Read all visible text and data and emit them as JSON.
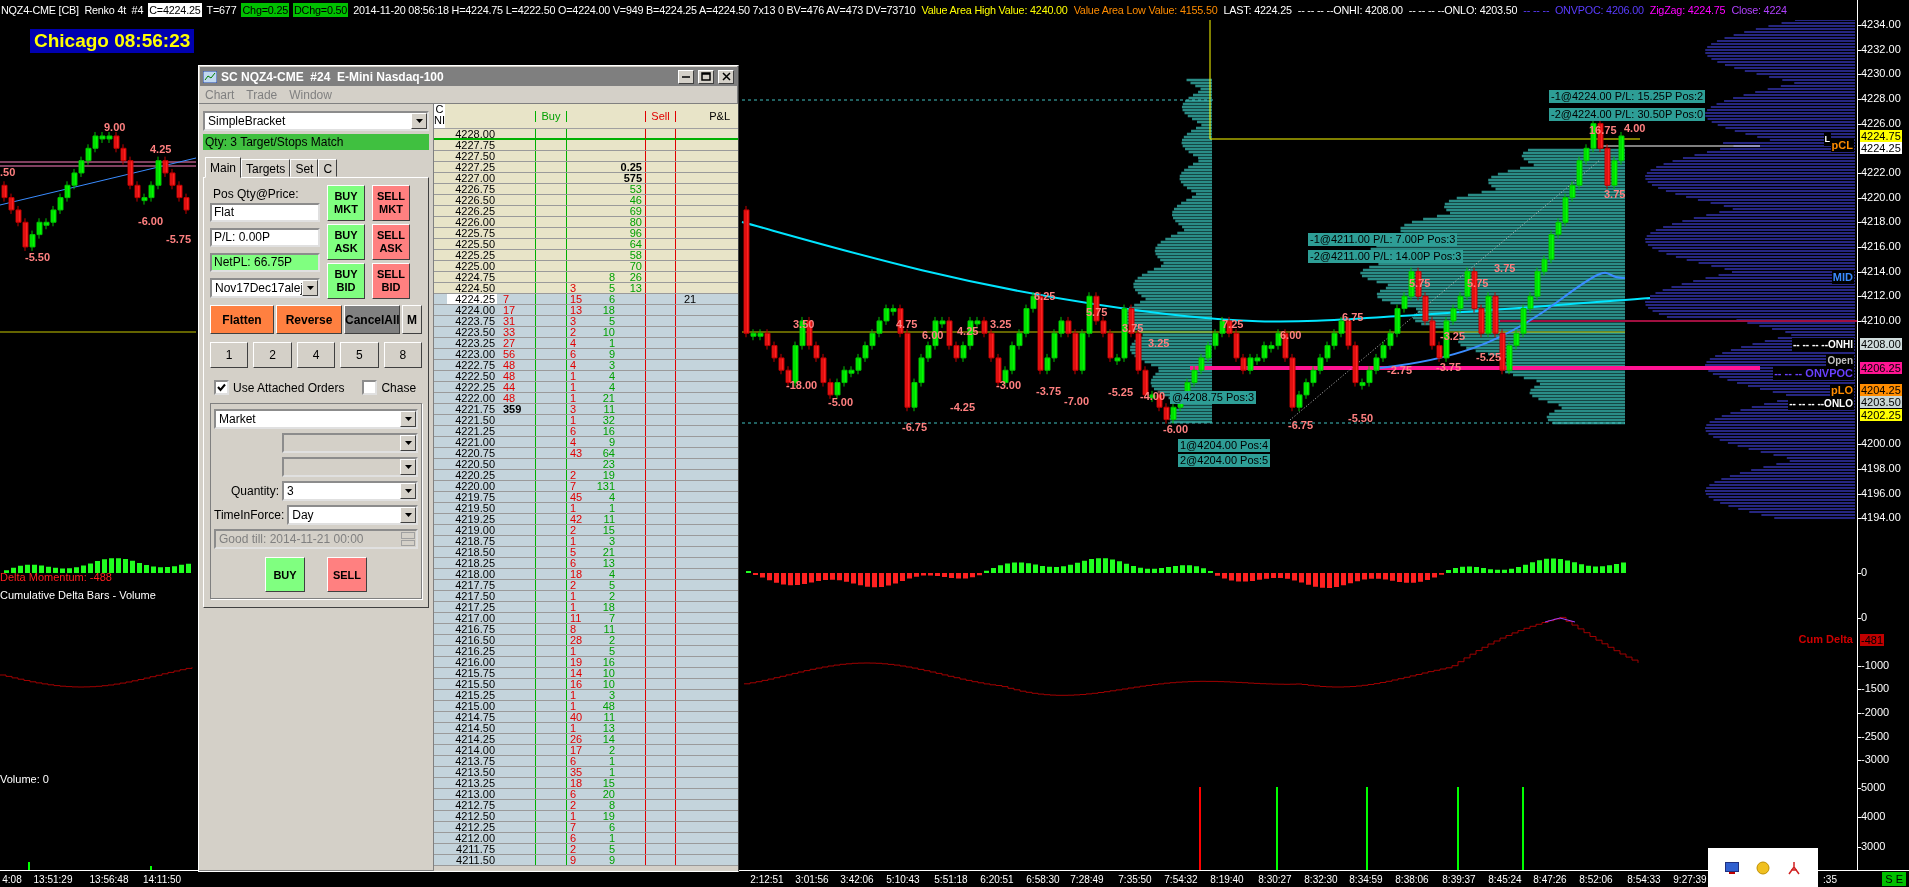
{
  "top_bar": {
    "items": [
      {
        "text": "NQZ4-CME [CB]  Renko 4t  #4",
        "color": "#ffffff",
        "boxed": false
      },
      {
        "text": "C=4224.25",
        "color": "#ffffff",
        "boxed": true
      },
      {
        "text": "T=677",
        "color": "#ffffff",
        "boxed": false
      },
      {
        "text": "Chg=0.25",
        "color": "#00c000",
        "boxed": true
      },
      {
        "text": "DChg=0.50",
        "color": "#00c000",
        "boxed": true
      },
      {
        "text": "2014-11-20 08:56:18 H=4224.75 L=4222.50 O=4224.00 V=949 B=4224.25 A=4224.50 7x13 0 BV=476 AV=473 DV=73710",
        "color": "#ffffff",
        "boxed": false
      },
      {
        "text": "Value Area High Value: 4240.00",
        "color": "#ffff00",
        "boxed": false
      },
      {
        "text": "Value Area Low Value: 4155.50",
        "color": "#ff8c00",
        "boxed": false
      },
      {
        "text": "LAST: 4224.25",
        "color": "#ffffff",
        "boxed": false
      },
      {
        "text": "-- -- -- --ONHI: 4208.00",
        "color": "#ffffff",
        "boxed": false
      },
      {
        "text": "-- -- -- --ONLO: 4203.50",
        "color": "#ffffff",
        "boxed": false
      },
      {
        "text": "-- -- --  ONVPOC: 4206.00",
        "color": "#5a3cff",
        "boxed": false
      },
      {
        "text": "ZigZag: 4224.75",
        "color": "#ff00ff",
        "boxed": false
      },
      {
        "text": "Close: 4224",
        "color": "#b040ff",
        "boxed": false
      }
    ]
  },
  "clock": "Chicago 08:56:23",
  "chart": {
    "swing_labels": [
      ".50",
      "9.00",
      "4.25",
      "-6.00",
      "-5.50",
      "-5.75",
      "3.50",
      "4.75",
      "6.00",
      "4.25",
      "3.25",
      "6.25",
      "5.75",
      "3.75",
      "3.25",
      "7.25",
      "6.00",
      "6.75",
      "5.75",
      "5.75",
      "3.75",
      "16.75",
      "4.00",
      "3.75",
      "-18.00",
      "-5.00",
      "-6.75",
      "-4.25",
      "-3.00",
      "-3.75",
      "-7.00",
      "-5.25",
      "-4.00",
      "-6.00",
      "-6.75",
      "-5.50",
      "-2.75",
      "-3.75",
      "-3.25",
      "-5.25"
    ],
    "order_labels": [
      "-1@4224.00 P/L: 15.25P Pos:2",
      "-2@4224.00 P/L: 30.50P Pos:0",
      "-1@4211.00 P/L: 7.00P Pos:3",
      "-2@4211.00 P/L: 14.00P Pos:3",
      "@4208.75 Pos:3",
      "1@4204.00 Pos:4",
      "2@4204.00 Pos:5"
    ],
    "level_labels": [
      {
        "text": "L",
        "color": "#ffffff"
      },
      {
        "text": "pCL",
        "color": "#ff8c00"
      },
      {
        "text": "MID",
        "color": "#3a8cff"
      },
      {
        "text": "-- -- -- --ONHI",
        "color": "#ffffff"
      },
      {
        "text": "Open",
        "color": "#c0c0c0"
      },
      {
        "text": "-- -- -- ONVPOC",
        "color": "#6a40ff"
      },
      {
        "text": "pLO",
        "color": "#ff8c00"
      },
      {
        "text": "-- -- -- --ONLO",
        "color": "#ffffff"
      },
      {
        "text": "Cum Delta",
        "color": "#d00000"
      }
    ],
    "pane_labels": [
      {
        "text": "Delta Momentum: -488",
        "color": "#ff2020"
      },
      {
        "text": "Cumulative Delta Bars - Volume",
        "color": "#ffffff"
      },
      {
        "text": "Volume: 0",
        "color": "#ffffff"
      }
    ]
  },
  "price_axis": {
    "ticks": [
      "4234.00",
      "4232.00",
      "4230.00",
      "4228.00",
      "4226.00",
      "4222.00",
      "4220.00",
      "4218.00",
      "4216.00",
      "4214.00",
      "4212.00",
      "4210.00",
      "4200.00",
      "4198.00",
      "4196.00",
      "4194.00"
    ],
    "markers": [
      {
        "text": "4224.75",
        "color": "#ffff00"
      },
      {
        "text": "4224.25",
        "color": "#ffffff"
      },
      {
        "text": "4208.00",
        "color": "#d0dcdc"
      },
      {
        "text": "4206.25",
        "color": "#ff1493"
      },
      {
        "text": "4204.25",
        "color": "#ff8c00"
      },
      {
        "text": "4203.50",
        "color": "#c8d4d4"
      },
      {
        "text": "4202.25",
        "color": "#ffff00"
      }
    ],
    "lower_ticks": [
      "0",
      "0",
      "-1000",
      "-1500",
      "-2000",
      "-2500",
      "-3000",
      "5000",
      "4000",
      "3000"
    ],
    "lower_markers": [
      {
        "text": "-481",
        "color": "#c00000"
      }
    ]
  },
  "time_axis": {
    "labels": [
      "4:08",
      "13:51:29",
      "13:56:48",
      "14:11:50",
      "2:12:51",
      "3:01:56",
      "3:42:06",
      "5:10:43",
      "5:51:18",
      "6:20:51",
      "6:58:30",
      "7:28:49",
      "7:35:50",
      "7:54:32",
      "8:19:40",
      "8:30:27",
      "8:32:30",
      "8:34:59",
      "8:38:06",
      "8:39:37",
      "8:45:24",
      "8:47:26",
      "8:52:06",
      "8:54:33",
      "9:27:39",
      ":35"
    ],
    "badge": "S E"
  },
  "order_window": {
    "title": "SC NQZ4-CME  #24  E-Mini Nasdaq-100",
    "menu": [
      {
        "label": "Chart",
        "disabled": true
      },
      {
        "label": "Trade",
        "disabled": true
      },
      {
        "label": "Window",
        "disabled": true
      }
    ],
    "strategy": "SimpleBracket",
    "status": "Qty: 3 Target/Stops Match",
    "tabs": [
      {
        "label": "Main",
        "selected": true
      },
      {
        "label": "Targets",
        "selected": false
      },
      {
        "label": "Set",
        "selected": false
      },
      {
        "label": "C",
        "selected": false
      }
    ],
    "position_label": "Pos Qty@Price:",
    "position": "Flat",
    "pl": "P/L: 0.00P",
    "net_pl": "NetPL: 66.75P",
    "account": "Nov17Dec17alej",
    "trade_buttons": [
      {
        "label": "BUY MKT",
        "kind": "buy"
      },
      {
        "label": "SELL MKT",
        "kind": "sell"
      },
      {
        "label": "BUY ASK",
        "kind": "buy"
      },
      {
        "label": "SELL ASK",
        "kind": "sell"
      },
      {
        "label": "BUY BID",
        "kind": "buy"
      },
      {
        "label": "SELL BID",
        "kind": "sell"
      }
    ],
    "action_buttons": [
      {
        "label": "Flatten",
        "kind": "accent"
      },
      {
        "label": "Reverse",
        "kind": "accent"
      },
      {
        "label": "CancelAll",
        "kind": "dark"
      },
      {
        "label": "M",
        "kind": "plain"
      }
    ],
    "quantity_presets": [
      "1",
      "2",
      "4",
      "5",
      "8"
    ],
    "attached_orders": {
      "label": "Use Attached Orders",
      "checked": true
    },
    "chase": {
      "label": "Chase",
      "checked": false
    },
    "order_type": "Market",
    "extra_dropdowns": [
      {
        "disabled": true
      },
      {
        "disabled": true
      }
    ],
    "quantity_label": "Quantity:",
    "quantity": "3",
    "tif_label": "TimeInForce:",
    "tif": "Day",
    "good_till": {
      "text": "Good till: 2014-11-21 00:00",
      "disabled": true
    },
    "submit_buttons": [
      {
        "label": "BUY",
        "kind": "buy"
      },
      {
        "label": "SELL",
        "kind": "sell"
      }
    ]
  },
  "ladder": {
    "stub_header": [
      "C",
      "NI"
    ],
    "columns": [
      "Buy",
      "Sell",
      "P&L"
    ],
    "rows": [
      {
        "price": "4228.00",
        "kind": "ask",
        "current": false
      },
      {
        "price": "4227.75",
        "kind": "ask",
        "current": false
      },
      {
        "price": "4227.50",
        "kind": "ask",
        "current": false
      },
      {
        "price": "4227.25",
        "kind": "ask",
        "current": false,
        "ask": "0.25",
        "color": "#000000"
      },
      {
        "price": "4227.00",
        "kind": "ask",
        "current": false,
        "ask": "575",
        "color": "#000000"
      },
      {
        "price": "4226.75",
        "kind": "ask",
        "current": false,
        "ask": "53"
      },
      {
        "price": "4226.50",
        "kind": "ask",
        "current": false,
        "ask": "46"
      },
      {
        "price": "4226.25",
        "kind": "ask",
        "current": false,
        "ask": "69"
      },
      {
        "price": "4226.00",
        "kind": "ask",
        "current": false,
        "ask": "80"
      },
      {
        "price": "4225.75",
        "kind": "ask",
        "current": false,
        "ask": "96"
      },
      {
        "price": "4225.50",
        "kind": "ask",
        "current": false,
        "ask": "64"
      },
      {
        "price": "4225.25",
        "kind": "ask",
        "current": false,
        "ask": "58"
      },
      {
        "price": "4225.00",
        "kind": "ask",
        "current": false,
        "ask": "70"
      },
      {
        "price": "4224.75",
        "kind": "ask",
        "current": false,
        "bought": "8",
        "ask": "26"
      },
      {
        "price": "4224.50",
        "kind": "ask",
        "current": false,
        "sold": "3",
        "bought": "5",
        "ask": "13"
      },
      {
        "price": "4224.25",
        "kind": "bid",
        "current": true,
        "bid": "7",
        "sold": "15",
        "bought": "6",
        "pnl": "21"
      },
      {
        "price": "4224.00",
        "kind": "bid",
        "current": false,
        "bid": "17",
        "sold": "13",
        "bought": "18"
      },
      {
        "price": "4223.75",
        "kind": "bid",
        "current": false,
        "bid": "31",
        "sold": "3",
        "bought": "5"
      },
      {
        "price": "4223.50",
        "kind": "bid",
        "current": false,
        "bid": "33",
        "sold": "2",
        "bought": "10"
      },
      {
        "price": "4223.25",
        "kind": "bid",
        "current": false,
        "bid": "27",
        "sold": "4",
        "bought": "1"
      },
      {
        "price": "4223.00",
        "kind": "bid",
        "current": false,
        "bid": "56",
        "sold": "6",
        "bought": "9"
      },
      {
        "price": "4222.75",
        "kind": "bid",
        "current": false,
        "bid": "48",
        "sold": "4",
        "bought": "3"
      },
      {
        "price": "4222.50",
        "kind": "bid",
        "current": false,
        "bid": "48",
        "sold": "1",
        "bought": "4"
      },
      {
        "price": "4222.25",
        "kind": "bid",
        "current": false,
        "bid": "44",
        "sold": "1",
        "bought": "4"
      },
      {
        "price": "4222.00",
        "kind": "bid",
        "current": false,
        "bid": "48",
        "sold": "1",
        "bought": "21"
      },
      {
        "price": "4221.75",
        "kind": "bid",
        "current": false,
        "bid": "359",
        "color": "#000000",
        "sold": "3",
        "bought": "11"
      },
      {
        "price": "4221.50",
        "kind": "bid",
        "current": false,
        "sold": "1",
        "bought": "32"
      },
      {
        "price": "4221.25",
        "kind": "bid",
        "current": false,
        "sold": "6",
        "bought": "16"
      },
      {
        "price": "4221.00",
        "kind": "bid",
        "current": false,
        "sold": "4",
        "bought": "9"
      },
      {
        "price": "4220.75",
        "kind": "bid",
        "current": false,
        "sold": "43",
        "bought": "64"
      },
      {
        "price": "4220.50",
        "kind": "bid",
        "current": false,
        "bought": "23"
      },
      {
        "price": "4220.25",
        "kind": "bid",
        "current": false,
        "sold": "2",
        "bought": "19"
      },
      {
        "price": "4220.00",
        "kind": "bid",
        "current": false,
        "sold": "7",
        "bought": "131"
      },
      {
        "price": "4219.75",
        "kind": "bid",
        "current": false,
        "sold": "45",
        "bought": "4"
      },
      {
        "price": "4219.50",
        "kind": "bid",
        "current": false,
        "sold": "1",
        "bought": "1"
      },
      {
        "price": "4219.25",
        "kind": "bid",
        "current": false,
        "sold": "42",
        "bought": "11"
      },
      {
        "price": "4219.00",
        "kind": "bid",
        "current": false,
        "sold": "2",
        "bought": "15"
      },
      {
        "price": "4218.75",
        "kind": "bid",
        "current": false,
        "sold": "1",
        "bought": "3"
      },
      {
        "price": "4218.50",
        "kind": "bid",
        "current": false,
        "sold": "5",
        "bought": "21"
      },
      {
        "price": "4218.25",
        "kind": "bid",
        "current": false,
        "sold": "6",
        "bought": "13"
      },
      {
        "price": "4218.00",
        "kind": "bid",
        "current": false,
        "sold": "18",
        "bought": "4"
      },
      {
        "price": "4217.75",
        "kind": "bid",
        "current": false,
        "sold": "2",
        "bought": "5"
      },
      {
        "price": "4217.50",
        "kind": "bid",
        "current": false,
        "sold": "1",
        "bought": "2"
      },
      {
        "price": "4217.25",
        "kind": "bid",
        "current": false,
        "sold": "1",
        "bought": "18"
      },
      {
        "price": "4217.00",
        "kind": "bid",
        "current": false,
        "sold": "11",
        "bought": "7"
      },
      {
        "price": "4216.75",
        "kind": "bid",
        "current": false,
        "sold": "8",
        "bought": "11"
      },
      {
        "price": "4216.50",
        "kind": "bid",
        "current": false,
        "sold": "28",
        "bought": "2"
      },
      {
        "price": "4216.25",
        "kind": "bid",
        "current": false,
        "sold": "1",
        "bought": "5"
      },
      {
        "price": "4216.00",
        "kind": "bid",
        "current": false,
        "sold": "19",
        "bought": "16"
      },
      {
        "price": "4215.75",
        "kind": "bid",
        "current": false,
        "sold": "14",
        "bought": "10"
      },
      {
        "price": "4215.50",
        "kind": "bid",
        "current": false,
        "sold": "16",
        "bought": "10"
      },
      {
        "price": "4215.25",
        "kind": "bid",
        "current": false,
        "sold": "1",
        "bought": "3"
      },
      {
        "price": "4215.00",
        "kind": "bid",
        "current": false,
        "sold": "1",
        "bought": "48"
      },
      {
        "price": "4214.75",
        "kind": "bid",
        "current": false,
        "sold": "40",
        "bought": "11"
      },
      {
        "price": "4214.50",
        "kind": "bid",
        "current": false,
        "sold": "1",
        "bought": "13"
      },
      {
        "price": "4214.25",
        "kind": "bid",
        "current": false,
        "sold": "26",
        "bought": "14"
      },
      {
        "price": "4214.00",
        "kind": "bid",
        "current": false,
        "sold": "17",
        "bought": "2"
      },
      {
        "price": "4213.75",
        "kind": "bid",
        "current": false,
        "sold": "6",
        "bought": "1"
      },
      {
        "price": "4213.50",
        "kind": "bid",
        "current": false,
        "sold": "35",
        "bought": "1"
      },
      {
        "price": "4213.25",
        "kind": "bid",
        "current": false,
        "sold": "18",
        "bought": "15"
      },
      {
        "price": "4213.00",
        "kind": "bid",
        "current": false,
        "sold": "6",
        "bought": "20"
      },
      {
        "price": "4212.75",
        "kind": "bid",
        "current": false,
        "sold": "2",
        "bought": "8"
      },
      {
        "price": "4212.50",
        "kind": "bid",
        "current": false,
        "sold": "1",
        "bought": "19"
      },
      {
        "price": "4212.25",
        "kind": "bid",
        "current": false,
        "sold": "7",
        "bought": "6"
      },
      {
        "price": "4212.00",
        "kind": "bid",
        "current": false,
        "sold": "6",
        "bought": "1"
      },
      {
        "price": "4211.75",
        "kind": "bid",
        "current": false,
        "sold": "2",
        "bought": "5"
      },
      {
        "price": "4211.50",
        "kind": "bid",
        "current": false,
        "sold": "9",
        "bought": "9"
      }
    ]
  }
}
